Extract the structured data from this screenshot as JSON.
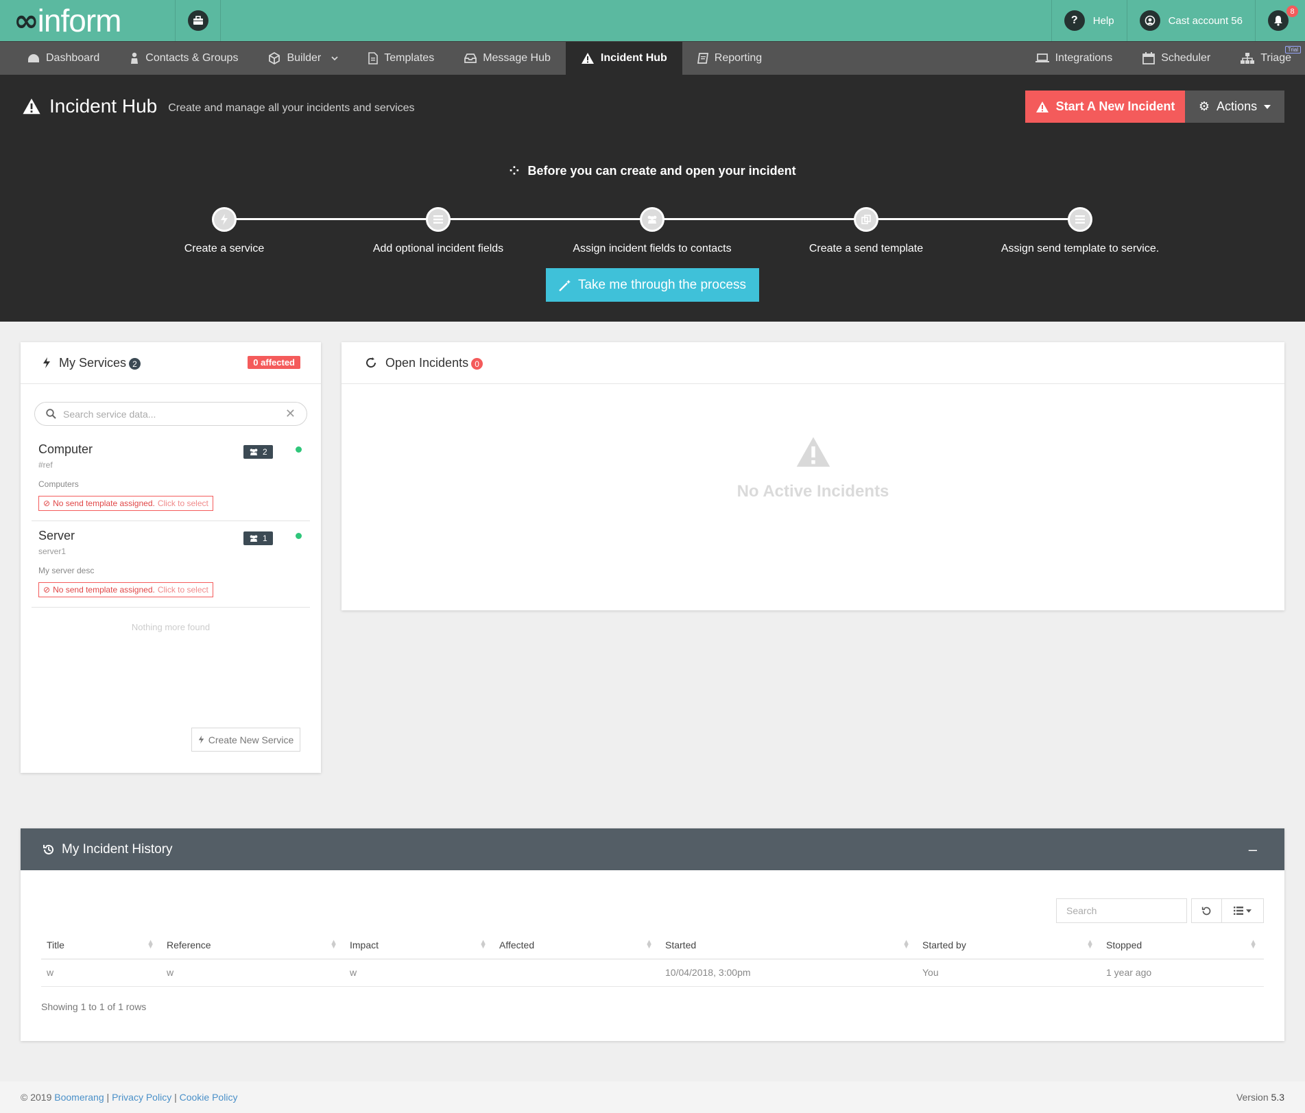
{
  "brand": {
    "logo_text": "inform"
  },
  "topbar": {
    "help_label": "Help",
    "account_label": "Cast account 56",
    "notifications_count": "8"
  },
  "nav": {
    "items": [
      {
        "label": "Dashboard",
        "icon": "dashboard-icon"
      },
      {
        "label": "Contacts & Groups",
        "icon": "user-icon"
      },
      {
        "label": "Builder",
        "icon": "cube-icon"
      },
      {
        "label": "Templates",
        "icon": "document-icon"
      },
      {
        "label": "Message Hub",
        "icon": "inbox-icon"
      },
      {
        "label": "Incident Hub",
        "icon": "warning-icon",
        "active": true
      },
      {
        "label": "Reporting",
        "icon": "book-icon"
      }
    ],
    "right_items": [
      {
        "label": "Integrations",
        "icon": "laptop-icon"
      },
      {
        "label": "Scheduler",
        "icon": "calendar-icon"
      },
      {
        "label": "Triage",
        "icon": "sitemap-icon",
        "badge": "Trial"
      }
    ]
  },
  "header": {
    "title": "Incident Hub",
    "subtitle": "Create and manage all your incidents and services",
    "start_button": "Start A New Incident",
    "actions_button": "Actions"
  },
  "steps": {
    "title": "Before you can create and open your incident",
    "items": [
      {
        "label": "Create a service",
        "icon": "bolt-icon"
      },
      {
        "label": "Add optional incident fields",
        "icon": "list-icon"
      },
      {
        "label": "Assign incident fields to contacts",
        "icon": "users-icon"
      },
      {
        "label": "Create a send template",
        "icon": "copy-icon"
      },
      {
        "label": "Assign send template to service.",
        "icon": "list-icon"
      }
    ],
    "process_button": "Take me through the process"
  },
  "services": {
    "title": "My Services",
    "count": "2",
    "affected_badge": "0 affected",
    "search_placeholder": "Search service data...",
    "items": [
      {
        "name": "Computer",
        "ref": "#ref",
        "description": "Computers",
        "group_count": "2",
        "warning": "No send template assigned.",
        "warning_link": "Click to select"
      },
      {
        "name": "Server",
        "ref": "server1",
        "description": "My server desc",
        "group_count": "1",
        "warning": "No send template assigned.",
        "warning_link": "Click to select"
      }
    ],
    "nothing_more": "Nothing more found",
    "create_button": "Create New Service"
  },
  "incidents": {
    "title": "Open Incidents",
    "count": "0",
    "empty_text": "No Active Incidents"
  },
  "history": {
    "title": "My Incident History",
    "minimize": "–",
    "search_placeholder": "Search",
    "columns": [
      "Title",
      "Reference",
      "Impact",
      "Affected",
      "Started",
      "Started by",
      "Stopped"
    ],
    "rows": [
      [
        "w",
        "w",
        "w",
        "",
        "10/04/2018, 3:00pm",
        "You",
        "1 year ago"
      ]
    ],
    "showing": "Showing 1 to 1 of 1 rows"
  },
  "footer": {
    "copyright": "© 2019",
    "links": [
      "Boomerang",
      "Privacy Policy",
      "Cookie Policy"
    ],
    "version_label": "Version",
    "version": "5.3"
  },
  "colors": {
    "brand_green": "#5bb9a0",
    "nav_gray": "#545454",
    "dark": "#2b2b2b",
    "danger": "#f45b5b",
    "info": "#3fc1d9",
    "status_green": "#2fc67a"
  }
}
